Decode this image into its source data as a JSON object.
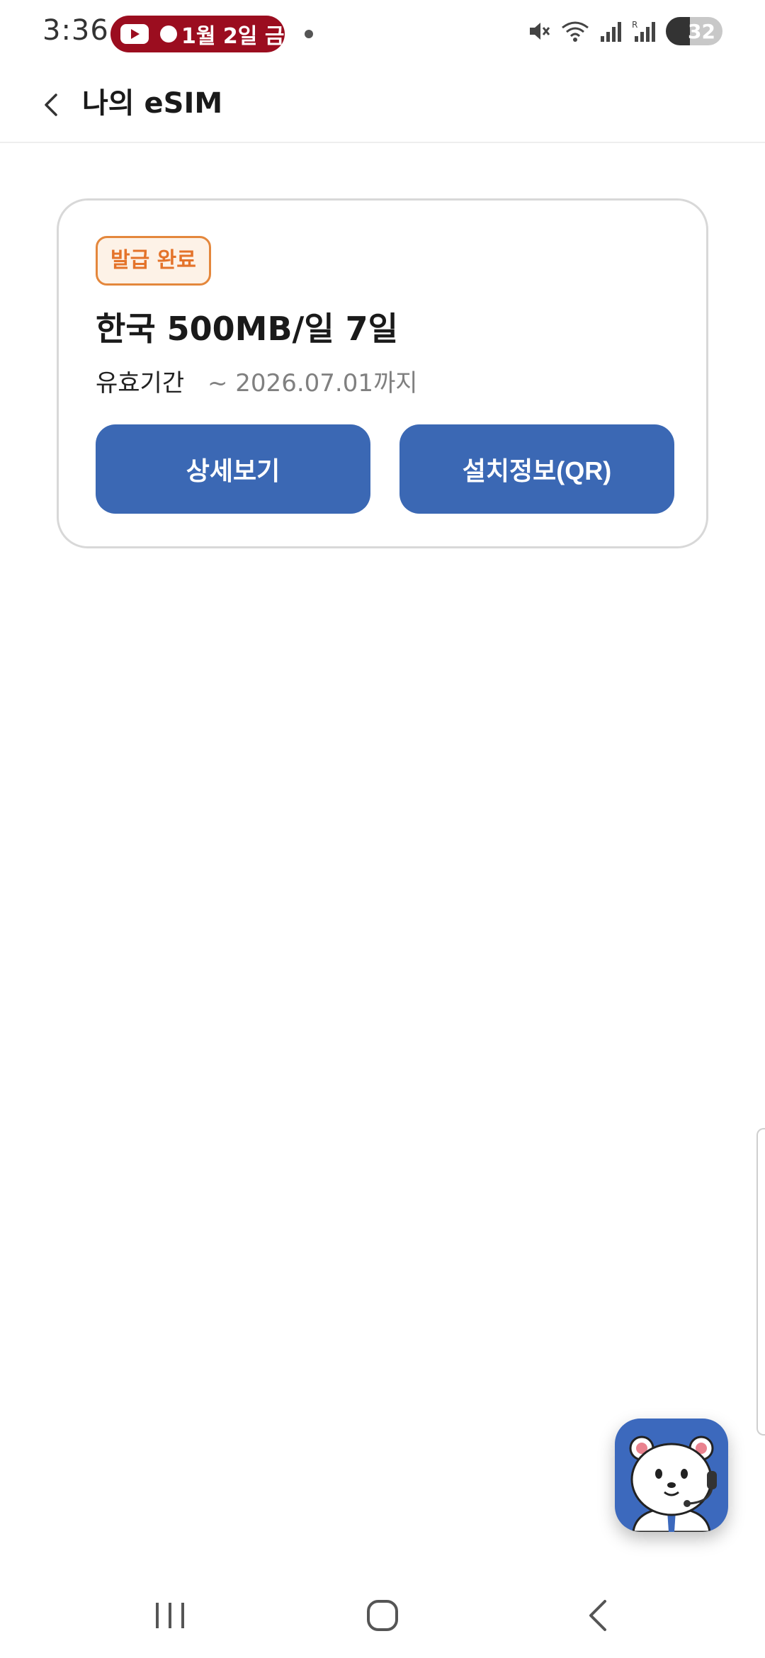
{
  "status_bar": {
    "time": "3:36",
    "notification_pill": "1월 2일 금",
    "battery_level": "32",
    "icons": [
      "mute-icon",
      "wifi-icon",
      "signal-icon",
      "roaming-signal-icon",
      "battery-charging-icon"
    ]
  },
  "header": {
    "title": "나의 eSIM",
    "back_icon": "chevron-left-icon"
  },
  "card": {
    "status_badge": "발급 완료",
    "plan_name": "한국 500MB/일 7일",
    "validity_label": "유효기간",
    "validity_value": "~ 2026.07.01까지",
    "detail_button": "상세보기",
    "qr_button": "설치정보(QR)"
  },
  "chat_fab": {
    "icon": "bear-support-mascot-icon"
  },
  "nav_bar": {
    "icons": [
      "recent-apps-icon",
      "home-icon",
      "back-icon"
    ]
  },
  "colors": {
    "accent": "#3b68b4",
    "badge_border": "#e4873c",
    "badge_text": "#e4732a",
    "pill": "#9b0d1f"
  }
}
